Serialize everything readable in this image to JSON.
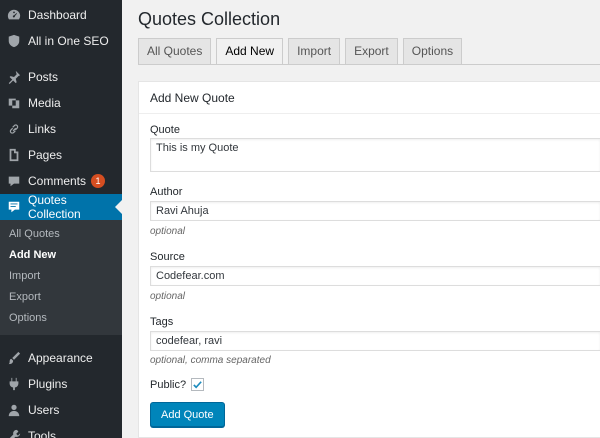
{
  "sidebar": {
    "top_items": [
      {
        "label": "Dashboard",
        "icon": "dashboard-icon"
      },
      {
        "label": "All in One SEO",
        "icon": "shield-icon"
      }
    ],
    "items": [
      {
        "label": "Posts",
        "icon": "pin-icon"
      },
      {
        "label": "Media",
        "icon": "media-icon"
      },
      {
        "label": "Links",
        "icon": "link-icon"
      },
      {
        "label": "Pages",
        "icon": "pages-icon"
      },
      {
        "label": "Comments",
        "icon": "comment-icon",
        "badge": "1"
      },
      {
        "label": "Quotes Collection",
        "icon": "quote-icon"
      }
    ],
    "submenu": [
      "All Quotes",
      "Add New",
      "Import",
      "Export",
      "Options"
    ],
    "bottom_items": [
      {
        "label": "Appearance",
        "icon": "brush-icon"
      },
      {
        "label": "Plugins",
        "icon": "plugin-icon"
      },
      {
        "label": "Users",
        "icon": "user-icon"
      },
      {
        "label": "Tools",
        "icon": "wrench-icon"
      }
    ]
  },
  "page": {
    "title": "Quotes Collection"
  },
  "tabs": [
    "All Quotes",
    "Add New",
    "Import",
    "Export",
    "Options"
  ],
  "form": {
    "heading": "Add New Quote",
    "quote_label": "Quote",
    "quote_value": "This is my Quote",
    "author_label": "Author",
    "author_value": "Ravi Ahuja",
    "author_hint": "optional",
    "source_label": "Source",
    "source_value": "Codefear.com",
    "source_hint": "optional",
    "tags_label": "Tags",
    "tags_value": "codefear, ravi",
    "tags_hint": "optional, comma separated",
    "public_label": "Public?",
    "public_checked": true,
    "submit_label": "Add Quote"
  },
  "colors": {
    "accent": "#0073aa",
    "button": "#0085ba",
    "sidebar": "#23282d",
    "badge": "#d54e21"
  }
}
